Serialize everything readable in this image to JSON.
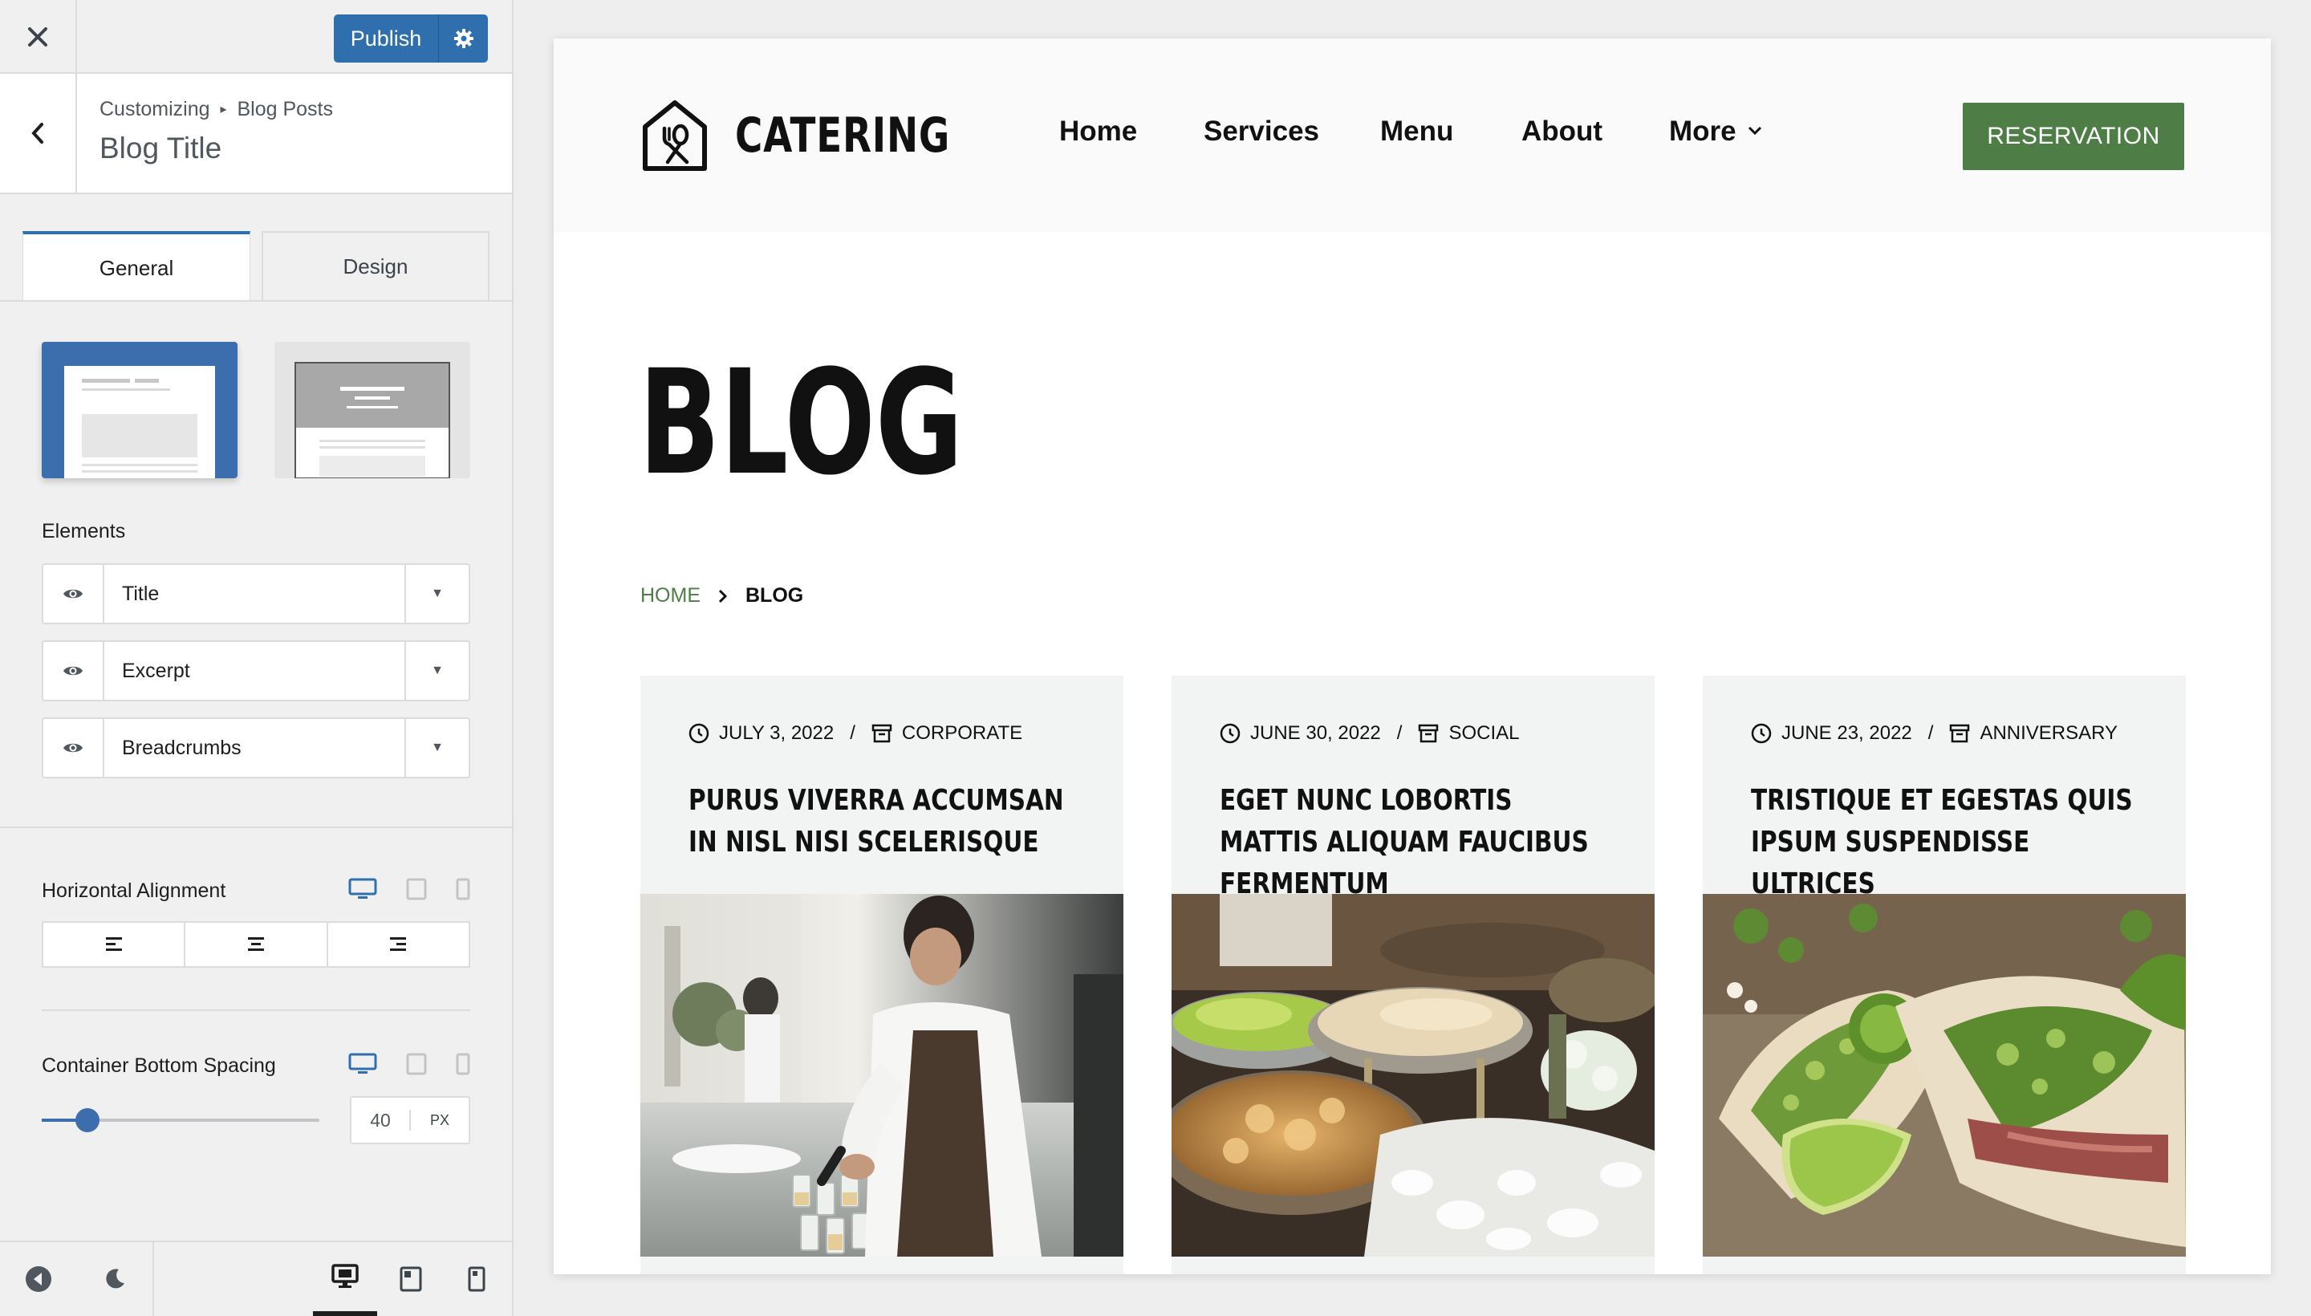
{
  "sidebar": {
    "publish_label": "Publish",
    "breadcrumb": {
      "root": "Customizing",
      "separator": "▸",
      "section": "Blog Posts"
    },
    "section_title": "Blog Title",
    "tabs": [
      {
        "label": "General"
      },
      {
        "label": "Design"
      }
    ],
    "elements_label": "Elements",
    "elements": [
      {
        "label": "Title"
      },
      {
        "label": "Excerpt"
      },
      {
        "label": "Breadcrumbs"
      }
    ],
    "horizontal_alignment_label": "Horizontal Alignment",
    "container_spacing_label": "Container Bottom Spacing",
    "spacing": {
      "value": "40",
      "unit": "PX",
      "slider_fraction": 0.09
    },
    "accent_color": "#2f6fad"
  },
  "preview": {
    "logo_text": "CATERING",
    "nav": [
      {
        "label": "Home"
      },
      {
        "label": "Services"
      },
      {
        "label": "Menu"
      },
      {
        "label": "About"
      },
      {
        "label": "More"
      }
    ],
    "cta_label": "RESERVATION",
    "brand_color": "#4e7d46",
    "page_title": "BLOG",
    "breadcrumb": {
      "home": "HOME",
      "current": "BLOG"
    },
    "posts": [
      {
        "date": "JULY 3, 2022",
        "category": "CORPORATE",
        "title": "PURUS VIVERRA ACCUMSAN IN NISL NISI SCELERISQUE"
      },
      {
        "date": "JUNE 30, 2022",
        "category": "SOCIAL",
        "title": "EGET NUNC LOBORTIS MATTIS ALIQUAM FAUCIBUS FERMENTUM"
      },
      {
        "date": "JUNE 23, 2022",
        "category": "ANNIVERSARY",
        "title": "TRISTIQUE ET EGESTAS QUIS IPSUM SUSPENDISSE ULTRICES"
      }
    ]
  }
}
